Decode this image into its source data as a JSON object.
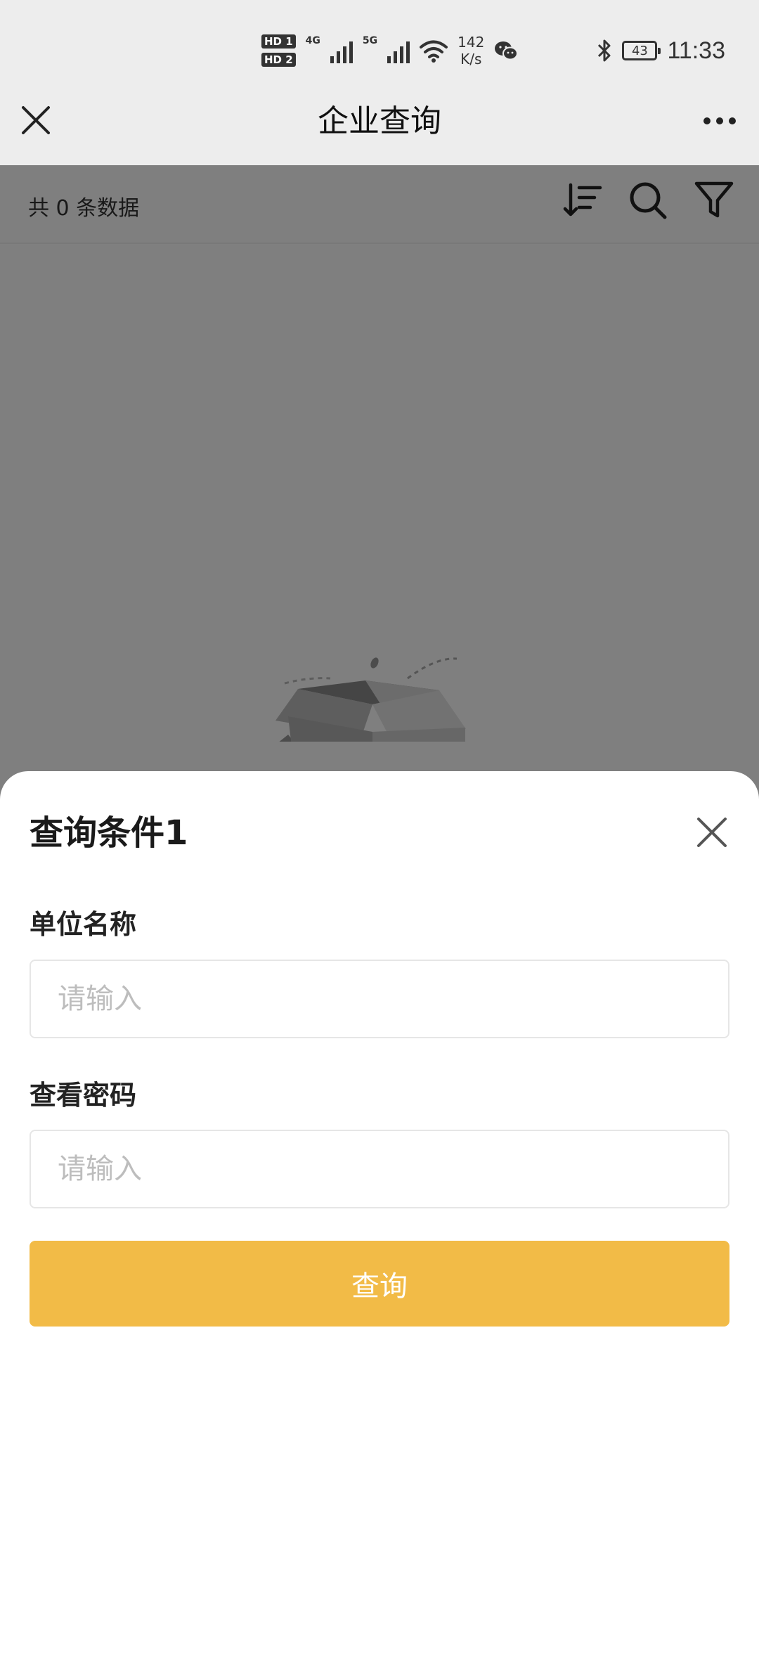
{
  "status_bar": {
    "sim_badges": [
      "HD 1",
      "HD 2"
    ],
    "network_labels": [
      "4G",
      "5G"
    ],
    "speed_value": "142",
    "speed_unit": "K/s",
    "battery_level": "43",
    "time": "11:33",
    "icons": [
      "signal-icon",
      "wifi-icon",
      "wechat-icon",
      "bluetooth-icon",
      "battery-icon"
    ]
  },
  "navbar": {
    "title": "企业查询",
    "icons": [
      "close-icon",
      "more-icon"
    ]
  },
  "toolbar": {
    "count_text": "共 0 条数据",
    "icons": [
      "sort-icon",
      "search-icon",
      "filter-icon"
    ]
  },
  "sheet": {
    "title": "查询条件1",
    "fields": [
      {
        "label": "单位名称",
        "placeholder": "请输入"
      },
      {
        "label": "查看密码",
        "placeholder": "请输入"
      }
    ],
    "submit_label": "查询"
  },
  "colors": {
    "accent": "#f2bb47",
    "bar_background": "#ededed",
    "mask": "rgba(0,0,0,0.5)"
  }
}
